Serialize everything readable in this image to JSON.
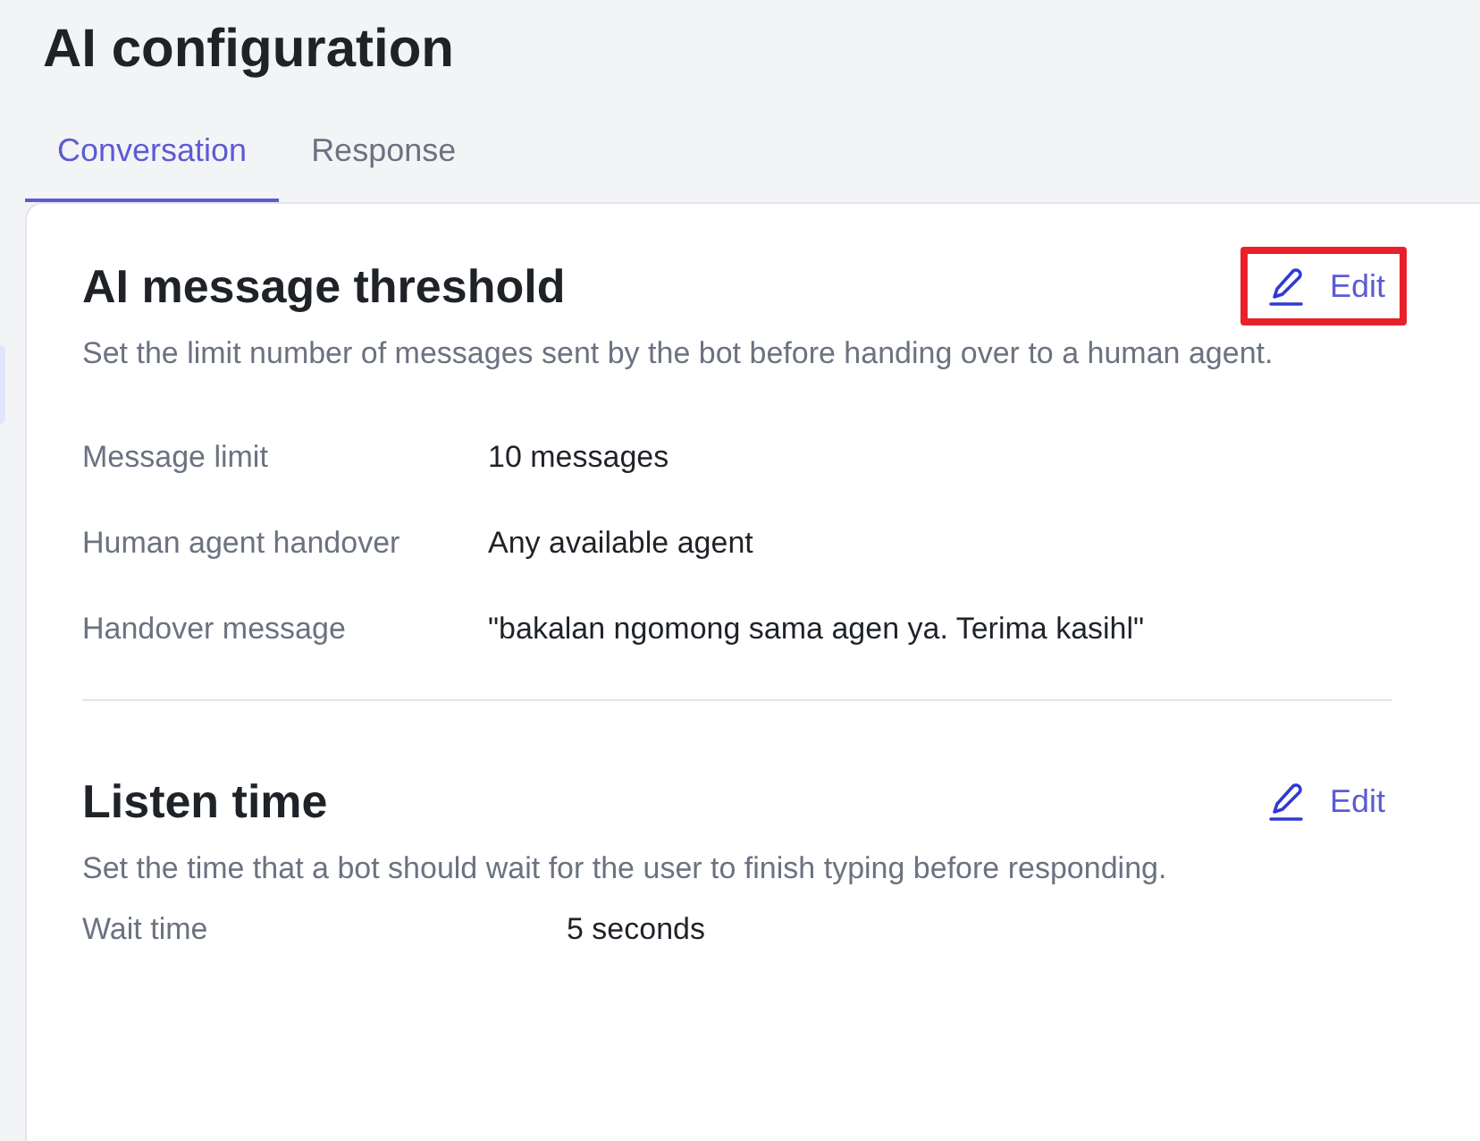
{
  "page_title": "AI configuration",
  "tabs": [
    {
      "label": "Conversation",
      "selected": true
    },
    {
      "label": "Response",
      "selected": false
    }
  ],
  "sections": [
    {
      "kind": "detailed",
      "title": "AI message threshold",
      "description": "Set the limit number of messages sent by the bot before handing over to a human agent.",
      "edit": {
        "label": "Edit",
        "highlighted": true
      },
      "fields": [
        {
          "label": "Message limit",
          "value": "10 messages"
        },
        {
          "label": "Human agent handover",
          "value": "Any available agent"
        },
        {
          "label": "Handover message",
          "value": "\"bakalan ngomong sama agen ya. Terima kasihl\""
        }
      ]
    },
    {
      "kind": "compact",
      "title": "Listen time",
      "description": "Set the time that a bot should wait for the user to finish typing before responding.",
      "edit": {
        "label": "Edit",
        "highlighted": false
      },
      "fields": [
        {
          "label": "Wait time",
          "value": "5 seconds"
        }
      ]
    }
  ]
}
